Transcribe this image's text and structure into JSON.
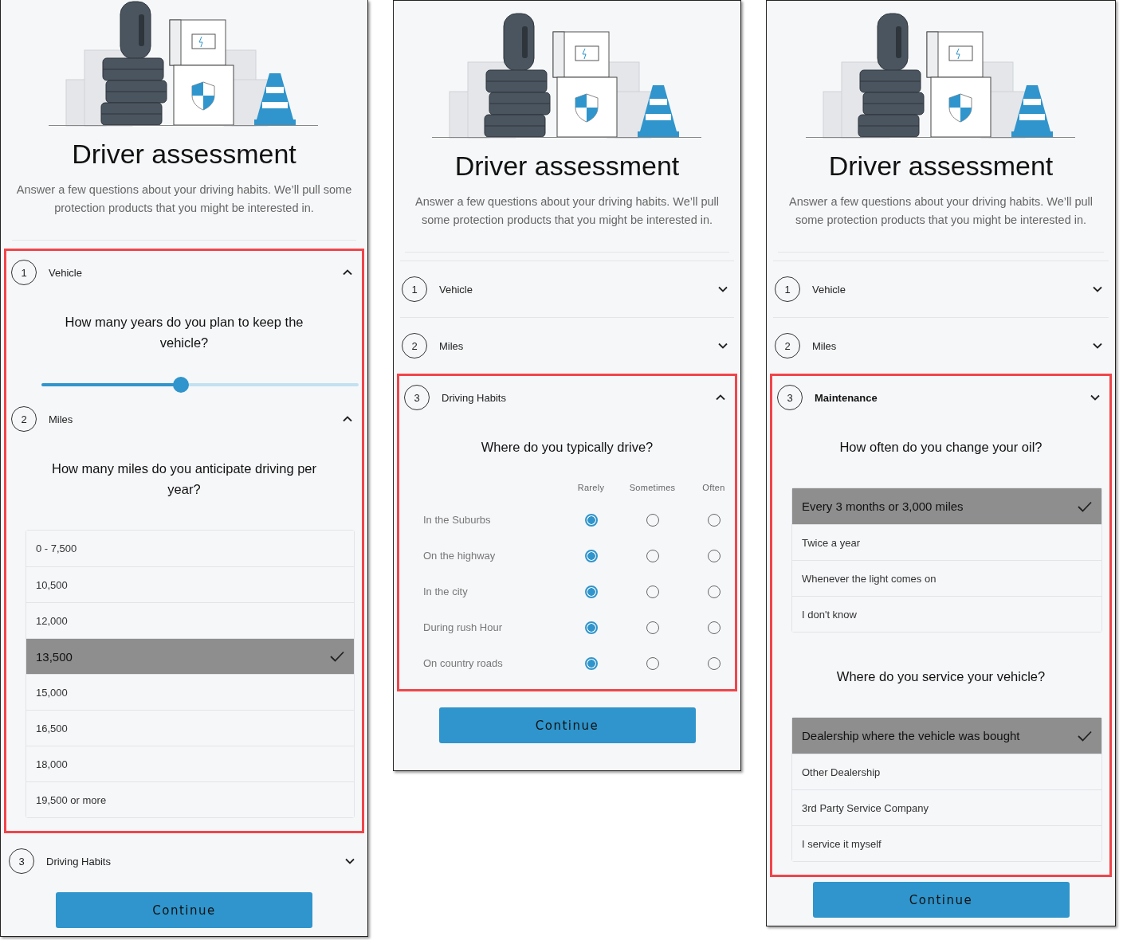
{
  "panels": [
    {
      "title": "Driver assessment",
      "description": "Answer a few questions about your driving habits. We’ll pull some protection products that you might be interested in.",
      "sections": [
        {
          "step": "1",
          "title": "Vehicle",
          "expanded": true,
          "current": false,
          "highlighted": true,
          "questions": [
            {
              "kind": "slider",
              "text": "How many years do you plan to keep the vehicle?",
              "level": 0.44
            }
          ]
        },
        {
          "step": "2",
          "title": "Miles",
          "expanded": true,
          "current": false,
          "highlighted": true,
          "questions": [
            {
              "kind": "options",
              "text": "How many miles do you anticipate driving per year?",
              "options": [
                {
                  "label": "0 - 7,500",
                  "selected": false
                },
                {
                  "label": "10,500",
                  "selected": false
                },
                {
                  "label": "12,000",
                  "selected": false
                },
                {
                  "label": "13,500",
                  "selected": true
                },
                {
                  "label": "15,000",
                  "selected": false
                },
                {
                  "label": "16,500",
                  "selected": false
                },
                {
                  "label": "18,000",
                  "selected": false
                },
                {
                  "label": "19,500 or more",
                  "selected": false
                }
              ]
            }
          ]
        },
        {
          "step": "3",
          "title": "Driving Habits",
          "expanded": false,
          "current": false,
          "highlighted": false
        }
      ],
      "button": "Continue"
    },
    {
      "title": "Driver assessment",
      "description": "Answer a few questions about your driving habits. We’ll pull some protection products that you might be interested in.",
      "sections": [
        {
          "step": "1",
          "title": "Vehicle",
          "expanded": false,
          "current": false,
          "highlighted": false
        },
        {
          "step": "2",
          "title": "Miles",
          "expanded": false,
          "current": false,
          "highlighted": false
        },
        {
          "step": "3",
          "title": "Driving Habits",
          "expanded": true,
          "current": false,
          "highlighted": true,
          "questions": [
            {
              "kind": "matrix",
              "text": "Where do you typically drive?",
              "columns": [
                "Rarely",
                "Sometimes",
                "Often"
              ],
              "rows": [
                {
                  "label": "In the Suburbs",
                  "choices": [
                    {
                      "selected": true
                    },
                    {
                      "selected": false
                    },
                    {
                      "selected": false
                    }
                  ]
                },
                {
                  "label": "On the highway",
                  "choices": [
                    {
                      "selected": true
                    },
                    {
                      "selected": false
                    },
                    {
                      "selected": false
                    }
                  ]
                },
                {
                  "label": "In the city",
                  "choices": [
                    {
                      "selected": true
                    },
                    {
                      "selected": false
                    },
                    {
                      "selected": false
                    }
                  ]
                },
                {
                  "label": "During rush Hour",
                  "choices": [
                    {
                      "selected": true
                    },
                    {
                      "selected": false
                    },
                    {
                      "selected": false
                    }
                  ]
                },
                {
                  "label": "On country roads",
                  "choices": [
                    {
                      "selected": true
                    },
                    {
                      "selected": false
                    },
                    {
                      "selected": false
                    }
                  ]
                }
              ]
            }
          ]
        }
      ],
      "button": "Continue"
    },
    {
      "title": "Driver assessment",
      "description": "Answer a few questions about your driving habits. We’ll pull some protection products that you might be interested in.",
      "sections": [
        {
          "step": "1",
          "title": "Vehicle",
          "expanded": false,
          "current": false,
          "highlighted": false
        },
        {
          "step": "2",
          "title": "Miles",
          "expanded": false,
          "current": false,
          "highlighted": false
        },
        {
          "step": "3",
          "title": "Maintenance",
          "expanded": false,
          "current": true,
          "highlighted": true,
          "questions": [
            {
              "kind": "options",
              "text": "How often do you change your oil?",
              "options": [
                {
                  "label": "Every 3 months or 3,000 miles",
                  "selected": true
                },
                {
                  "label": "Twice a year",
                  "selected": false
                },
                {
                  "label": "Whenever the light comes on",
                  "selected": false
                },
                {
                  "label": "I don't know",
                  "selected": false
                }
              ]
            },
            {
              "kind": "options",
              "text": "Where do you service your vehicle?",
              "options": [
                {
                  "label": "Dealership where the vehicle was bought",
                  "selected": true
                },
                {
                  "label": "Other Dealership",
                  "selected": false
                },
                {
                  "label": "3rd Party Service Company",
                  "selected": false
                },
                {
                  "label": "I service it myself",
                  "selected": false
                }
              ]
            }
          ]
        }
      ],
      "button": "Continue"
    }
  ]
}
